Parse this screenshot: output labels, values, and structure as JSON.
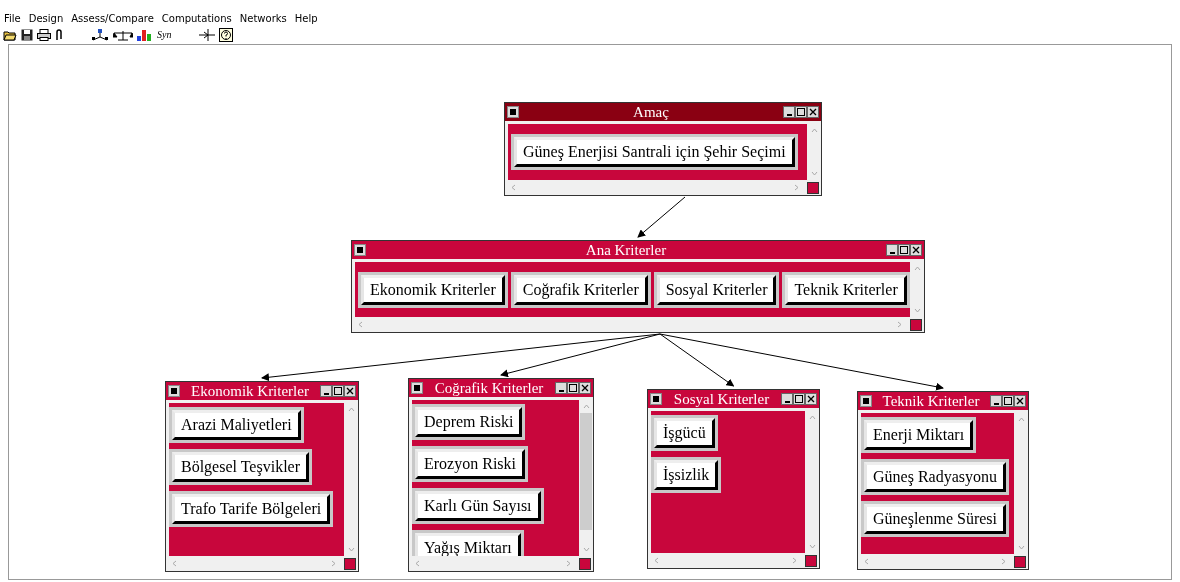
{
  "menu": [
    "File",
    "Design",
    "Assess/Compare",
    "Computations",
    "Networks",
    "Help"
  ],
  "toolbar": {
    "syn_label": "Syn"
  },
  "nodes": [
    {
      "title": "Amaç",
      "color": "#8a0012",
      "vertical_thumb": false,
      "items": [
        "Güneş Enerjisi Santrali için Şehir Seçimi"
      ]
    },
    {
      "title": "Ana Kriterler",
      "color": "#c8063c",
      "vertical_thumb": false,
      "items": [
        "Ekonomik Kriterler",
        "Coğrafik Kriterler",
        "Sosyal Kriterler",
        "Teknik Kriterler"
      ]
    },
    {
      "title": "Ekonomik Kriterler",
      "color": "#c8063c",
      "vertical_thumb": false,
      "items": [
        "Arazi Maliyetleri",
        "Bölgesel Teşvikler",
        "Trafo Tarife Bölgeleri"
      ]
    },
    {
      "title": "Coğrafik Kriterler",
      "color": "#c8063c",
      "vertical_thumb": true,
      "items": [
        "Deprem Riski",
        "Erozyon Riski",
        "Karlı Gün Sayısı",
        "Yağış Miktarı"
      ]
    },
    {
      "title": "Sosyal Kriterler",
      "color": "#c8063c",
      "vertical_thumb": false,
      "items": [
        "İşgücü",
        "İşsizlik"
      ]
    },
    {
      "title": "Teknik Kriterler",
      "color": "#c8063c",
      "vertical_thumb": false,
      "items": [
        "Enerji Miktarı",
        "Güneş Radyasyonu",
        "Güneşlenme Süresi"
      ]
    }
  ]
}
